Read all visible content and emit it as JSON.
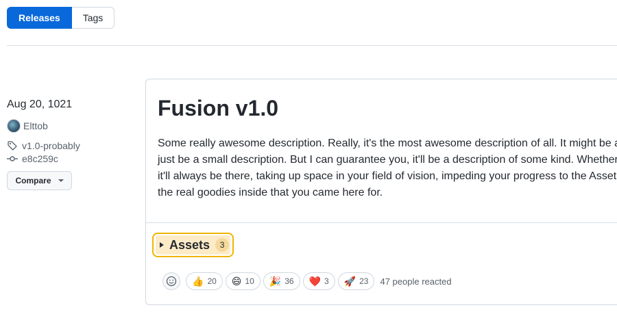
{
  "tabs": {
    "releases": "Releases",
    "tags": "Tags"
  },
  "release": {
    "date": "Aug 20, 1021",
    "author": "Elttob",
    "tag": "v1.0-probably",
    "commit": "e8c259c",
    "compare_label": "Compare",
    "title": "Fusion v1.0",
    "description_lines": [
      "Some really awesome description. Really, it's the most awesome description of all. It might be a",
      "just be a small description. But I can guarantee you, it'll be a description of some kind. Whether",
      "it'll always be there, taking up space in your field of vision, impeding your progress to the Asset",
      "the real goodies inside that you came here for."
    ],
    "assets_label": "Assets",
    "assets_count": "3"
  },
  "reactions": {
    "items": [
      {
        "icon": "thumbs-up",
        "emoji": "👍",
        "count": "20"
      },
      {
        "icon": "laugh",
        "emoji": "😄",
        "count": "10"
      },
      {
        "icon": "tada",
        "emoji": "🎉",
        "count": "36"
      },
      {
        "icon": "heart",
        "emoji": "❤️",
        "count": "3"
      },
      {
        "icon": "rocket",
        "emoji": "🚀",
        "count": "23"
      }
    ],
    "summary": "47 people reacted"
  },
  "colors": {
    "accent": "#0969da",
    "highlight_border": "#f0b400",
    "highlight_bg": "#fdebc8"
  }
}
